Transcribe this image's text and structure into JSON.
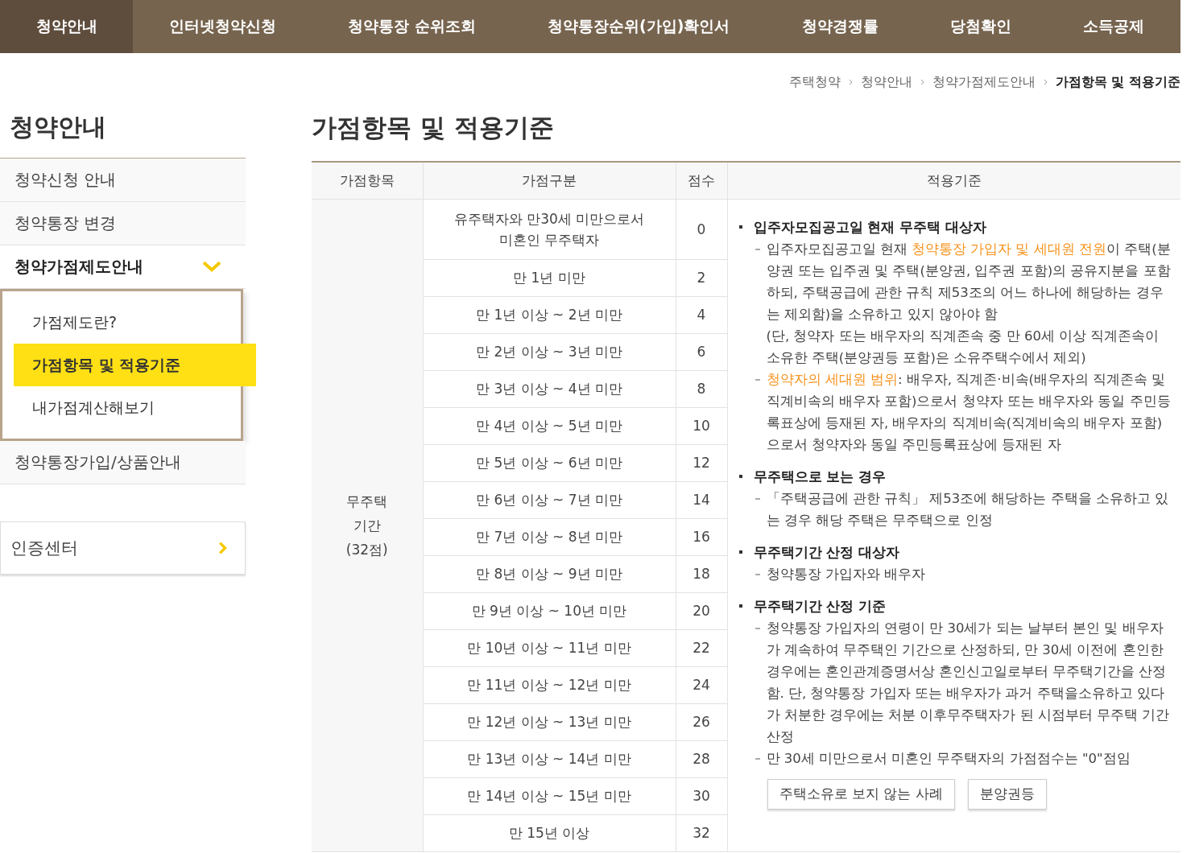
{
  "nav": [
    {
      "label": "청약안내",
      "selected": true
    },
    {
      "label": "인터넷청약신청",
      "selected": false
    },
    {
      "label": "청약통장 순위조회",
      "selected": false
    },
    {
      "label": "청약통장순위(가입)확인서",
      "selected": false
    },
    {
      "label": "청약경쟁률",
      "selected": false
    },
    {
      "label": "당첨확인",
      "selected": false
    },
    {
      "label": "소득공제",
      "selected": false
    }
  ],
  "breadcrumb": [
    {
      "label": "주택청약",
      "current": false
    },
    {
      "label": "청약안내",
      "current": false
    },
    {
      "label": "청약가점제도안내",
      "current": false
    },
    {
      "label": "가점항목 및 적용기준",
      "current": true
    }
  ],
  "sidebar": {
    "title": "청약안내",
    "items": [
      {
        "label": "청약신청 안내",
        "selected": false,
        "expanded": false
      },
      {
        "label": "청약통장 변경",
        "selected": false,
        "expanded": false
      },
      {
        "label": "청약가점제도안내",
        "selected": true,
        "expanded": true,
        "children": [
          {
            "label": "가점제도란?",
            "selected": false
          },
          {
            "label": "가점항목 및 적용기준",
            "selected": true
          },
          {
            "label": "내가점계산해보기",
            "selected": false
          }
        ]
      },
      {
        "label": "청약통장가입/상품안내",
        "selected": false,
        "expanded": false
      }
    ],
    "cert_link": "인증센터"
  },
  "page_title": "가점항목 및 적용기준",
  "table": {
    "columns": [
      "가점항목",
      "가점구분",
      "점수",
      "적용기준"
    ],
    "group_label": [
      "무주택",
      "기간",
      "(32점)"
    ],
    "rows": [
      {
        "category": [
          "유주택자와 만30세 미만으로서",
          "미혼인 무주택자"
        ],
        "score": "0"
      },
      {
        "category": [
          "만 1년 미만"
        ],
        "score": "2"
      },
      {
        "category": [
          "만 1년 이상 ~ 2년 미만"
        ],
        "score": "4"
      },
      {
        "category": [
          "만 2년 이상 ~ 3년 미만"
        ],
        "score": "6"
      },
      {
        "category": [
          "만 3년 이상 ~ 4년 미만"
        ],
        "score": "8"
      },
      {
        "category": [
          "만 4년 이상 ~ 5년 미만"
        ],
        "score": "10"
      },
      {
        "category": [
          "만 5년 이상 ~ 6년 미만"
        ],
        "score": "12"
      },
      {
        "category": [
          "만 6년 이상 ~ 7년 미만"
        ],
        "score": "14"
      },
      {
        "category": [
          "만 7년 이상 ~ 8년 미만"
        ],
        "score": "16"
      },
      {
        "category": [
          "만 8년 이상 ~ 9년 미만"
        ],
        "score": "18"
      },
      {
        "category": [
          "만 9년 이상 ~ 10년 미만"
        ],
        "score": "20"
      },
      {
        "category": [
          "만 10년 이상 ~ 11년 미만"
        ],
        "score": "22"
      },
      {
        "category": [
          "만 11년 이상 ~ 12년 미만"
        ],
        "score": "24"
      },
      {
        "category": [
          "만 12년 이상 ~ 13년 미만"
        ],
        "score": "26"
      },
      {
        "category": [
          "만 13년 이상 ~ 14년 미만"
        ],
        "score": "28"
      },
      {
        "category": [
          "만 14년 이상 ~ 15년 미만"
        ],
        "score": "30"
      },
      {
        "category": [
          "만 15년 이상"
        ],
        "score": "32"
      }
    ],
    "criteria": [
      {
        "heading": "입주자모집공고일 현재 무주택 대상자",
        "items": [
          [
            [
              {
                "text": "입주자모집공고일 현재 ",
                "highlight": false
              },
              {
                "text": "청약통장 가입자 및 세대원 전원",
                "highlight": true
              },
              {
                "text": "이 주택(분양권 또는 입주권 및 주택(분양권, 입주권 포함)의 공유지분을 포함하되, 주택공급에 관한 규칙 제53조의 어느 하나에 해당하는 경우는 제외함)을 소유하고 있지 않아야 함",
                "highlight": false
              }
            ],
            [
              {
                "text": "(단, 청약자 또는 배우자의 직계존속 중 만 60세 이상 직계존속이 소유한 주택(분양권등 포함)은 소유주택수에서 제외)",
                "highlight": false
              }
            ]
          ],
          [
            [
              {
                "text": "청약자의 세대원 범위",
                "highlight": true
              },
              {
                "text": ": 배우자, 직계존·비속(배우자의 직계존속 및 직계비속의 배우자 포함)으로서 청약자 또는 배우자와 동일 주민등록표상에 등재된 자, 배우자의 직계비속(직계비속의 배우자 포함)으로서 청약자와 동일 주민등록표상에 등재된 자",
                "highlight": false
              }
            ]
          ]
        ]
      },
      {
        "heading": "무주택으로 보는 경우",
        "items": [
          [
            [
              {
                "text": "「주택공급에 관한 규칙」 제53조에 해당하는 주택을 소유하고 있는 경우 해당 주택은 무주택으로 인정",
                "highlight": false
              }
            ]
          ]
        ]
      },
      {
        "heading": "무주택기간 산정 대상자",
        "items": [
          [
            [
              {
                "text": "청약통장 가입자와 배우자",
                "highlight": false
              }
            ]
          ]
        ]
      },
      {
        "heading": "무주택기간 산정 기준",
        "items": [
          [
            [
              {
                "text": "청약통장 가입자의 연령이 만 30세가 되는 날부터 본인 및 배우자가 계속하여 무주택인 기간으로 산정하되, 만 30세 이전에 혼인한 경우에는 혼인관계증명서상 혼인신고일로부터 무주택기간을 산정함. 단, 청약통장 가입자 또는 배우자가 과거 주택을소유하고 있다가 처분한 경우에는 처분 이후무주택자가 된 시점부터 무주택 기간 산정",
                "highlight": false
              }
            ]
          ],
          [
            [
              {
                "text": "만 30세 미만으로서 미혼인 무주택자의 가점점수는 \"0\"점임",
                "highlight": false
              }
            ]
          ]
        ]
      }
    ],
    "buttons": [
      "주택소유로 보지 않는 사례",
      "분양권등"
    ]
  }
}
